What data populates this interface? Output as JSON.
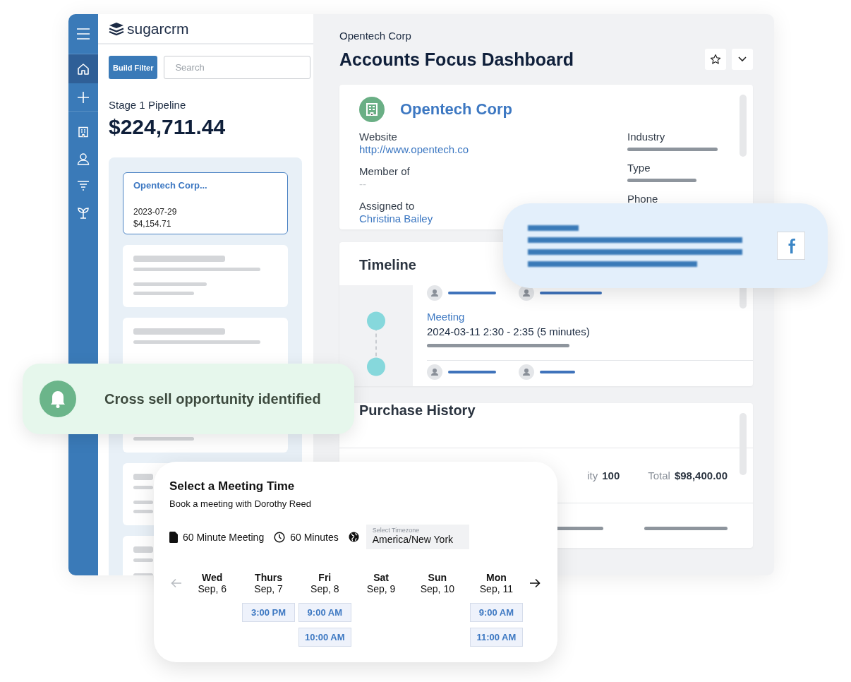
{
  "nav": [
    {
      "kind": "menu",
      "selected": false
    },
    {
      "kind": "home",
      "selected": true
    },
    {
      "kind": "add",
      "selected": false
    },
    {
      "kind": "building",
      "selected": false
    },
    {
      "kind": "person",
      "selected": false
    },
    {
      "kind": "filter",
      "selected": false
    },
    {
      "kind": "sprout",
      "selected": false
    }
  ],
  "logo": "**sugar**crm",
  "filter_button": "Build Filter",
  "search": {
    "placeholder": "Search"
  },
  "pipeline": {
    "label": "Stage 1 Pipeline",
    "amount": "$224,711.44"
  },
  "opportunities": [
    {
      "name": "Opentech Corp...",
      "date": "2023-07-29",
      "amount": "$4,154.71",
      "selected": true
    }
  ],
  "header": {
    "breadcrumb": "Opentech Corp",
    "title": "Accounts Focus Dashboard"
  },
  "account": {
    "name": "Opentech Corp",
    "fields_left": [
      {
        "label": "Website",
        "value": "http://www.opentech.co",
        "kind": "link"
      },
      {
        "label": "Member of",
        "value": "--",
        "kind": "empty"
      },
      {
        "label": "Assigned to",
        "value": "Christina Bailey",
        "kind": "link"
      }
    ],
    "fields_right": [
      {
        "label": "Industry"
      },
      {
        "label": "Type"
      },
      {
        "label": "Phone"
      }
    ]
  },
  "timeline": {
    "title": "Timeline",
    "entries": [
      {
        "type": "Meeting",
        "time": "2024-03-11 2:30 - 2:35 (5 minutes)"
      }
    ]
  },
  "purchase_history": {
    "title": "Purchase History",
    "fields": [
      {
        "label": "ity",
        "value": "100"
      },
      {
        "label": "Total",
        "value": "$98,400.00"
      }
    ]
  },
  "notification": {
    "message": "Cross sell opportunity identified"
  },
  "meeting": {
    "title": "Select a Meeting Time",
    "subtitle": "Book a meeting with Dorothy Reed",
    "details": [
      {
        "kind": "document",
        "text": "60 Minute Meeting"
      },
      {
        "kind": "clock",
        "text": "60 Minutes"
      }
    ],
    "timezone": {
      "label": "Select Timezone",
      "value": "America/New York"
    },
    "prev": {
      "disabled": true
    },
    "next": {
      "disabled": false
    },
    "days": [
      {
        "day": "Wed",
        "date": "Sep, 6"
      },
      {
        "day": "Thurs",
        "date": "Sep, 7",
        "slots": [
          "3:00 PM"
        ]
      },
      {
        "day": "Fri",
        "date": "Sep, 8",
        "slots": [
          "9:00 AM",
          "10:00 AM"
        ]
      },
      {
        "day": "Sat",
        "date": "Sep, 9"
      },
      {
        "day": "Sun",
        "date": "Sep, 10"
      },
      {
        "day": "Mon",
        "date": "Sep, 11",
        "slots": [
          "9:00 AM",
          "11:00 AM"
        ]
      }
    ]
  }
}
